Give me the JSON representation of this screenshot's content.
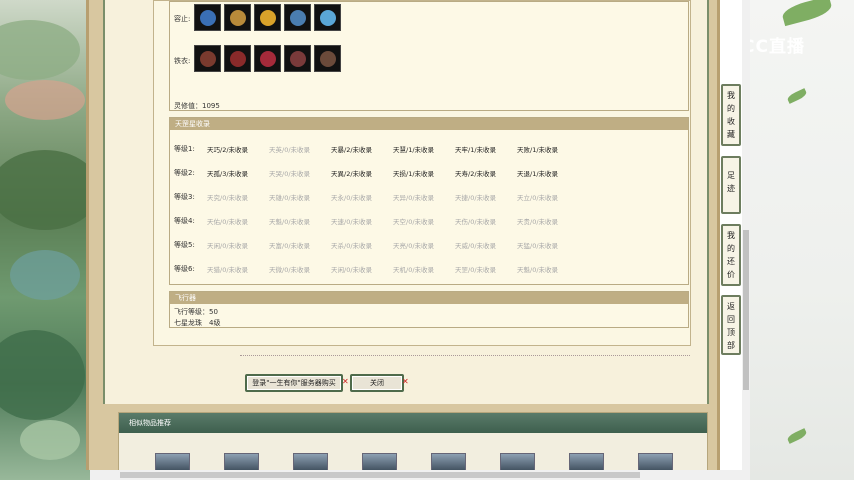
{
  "colors": {
    "accent": "#bfae84",
    "frame": "#d8c7a0",
    "panel": "#fdf9e6",
    "button_border": "#4f6b4b",
    "close_x": "#cc2222",
    "related_header": "#3e5f4e"
  },
  "equipment": {
    "rongzhi_label": "容止:",
    "tieyi_label": "铁衣:",
    "rongzhi_icons": [
      "bag-icon",
      "spear-icon",
      "gold-ring-icon",
      "gem-icon",
      "crystal-icon"
    ],
    "tieyi_icons": [
      "shield-icon",
      "ring-icon",
      "red-ring-icon",
      "staff-icon",
      "armor-icon"
    ],
    "spirit_value": "灵修值：1095"
  },
  "stars": {
    "title": "天罡星收录",
    "rows": [
      {
        "level": "等级1:",
        "cells": [
          {
            "text": "天巧/2/未收录",
            "on": true
          },
          {
            "text": "天英/0/未收录",
            "on": false
          },
          {
            "text": "天暴/2/未收录",
            "on": true
          },
          {
            "text": "天慧/1/未收录",
            "on": true
          },
          {
            "text": "天牢/1/未收录",
            "on": true
          },
          {
            "text": "天败/1/未收录",
            "on": true
          }
        ]
      },
      {
        "level": "等级2:",
        "cells": [
          {
            "text": "天孤/3/未收录",
            "on": true
          },
          {
            "text": "天哭/0/未收录",
            "on": false
          },
          {
            "text": "天異/2/未收录",
            "on": true
          },
          {
            "text": "天损/1/未收录",
            "on": true
          },
          {
            "text": "天寿/2/未收录",
            "on": true
          },
          {
            "text": "天退/1/未收录",
            "on": true
          }
        ]
      },
      {
        "level": "等级3:",
        "cells": [
          {
            "text": "天究/0/未收录",
            "on": false
          },
          {
            "text": "天雄/0/未收录",
            "on": false
          },
          {
            "text": "天永/0/未收录",
            "on": false
          },
          {
            "text": "天异/0/未收录",
            "on": false
          },
          {
            "text": "天捷/0/未收录",
            "on": false
          },
          {
            "text": "天立/0/未收录",
            "on": false
          }
        ]
      },
      {
        "level": "等级4:",
        "cells": [
          {
            "text": "天佑/0/未收录",
            "on": false
          },
          {
            "text": "天魁/0/未收录",
            "on": false
          },
          {
            "text": "天速/0/未收录",
            "on": false
          },
          {
            "text": "天空/0/未收录",
            "on": false
          },
          {
            "text": "天伤/0/未收录",
            "on": false
          },
          {
            "text": "天贵/0/未收录",
            "on": false
          }
        ]
      },
      {
        "level": "等级5:",
        "cells": [
          {
            "text": "天闲/0/未收录",
            "on": false
          },
          {
            "text": "天富/0/未收录",
            "on": false
          },
          {
            "text": "天杀/0/未收录",
            "on": false
          },
          {
            "text": "天亮/0/未收录",
            "on": false
          },
          {
            "text": "天威/0/未收录",
            "on": false
          },
          {
            "text": "天猛/0/未收录",
            "on": false
          }
        ]
      },
      {
        "level": "等级6:",
        "cells": [
          {
            "text": "天猎/0/未收录",
            "on": false
          },
          {
            "text": "天微/0/未收录",
            "on": false
          },
          {
            "text": "天闲/0/未收录",
            "on": false
          },
          {
            "text": "天机/0/未收录",
            "on": false
          },
          {
            "text": "天罡/0/未收录",
            "on": false
          },
          {
            "text": "天魁/0/未收录",
            "on": false
          }
        ]
      }
    ]
  },
  "flight": {
    "title": "飞行器",
    "level_line": "飞行等级：50",
    "item_line": "七星龙珠　4级"
  },
  "buttons": {
    "login_label": "登录\"一生有你\"服务器购买",
    "close_label": "关闭",
    "x_mark": "✕"
  },
  "related": {
    "title": "相似物品推荐",
    "avatar_count": 8
  },
  "sidebar": {
    "items": [
      "我的收藏",
      "足迹",
      "我的还价",
      "返回顶部"
    ]
  },
  "logo": {
    "text": "CC直播"
  }
}
